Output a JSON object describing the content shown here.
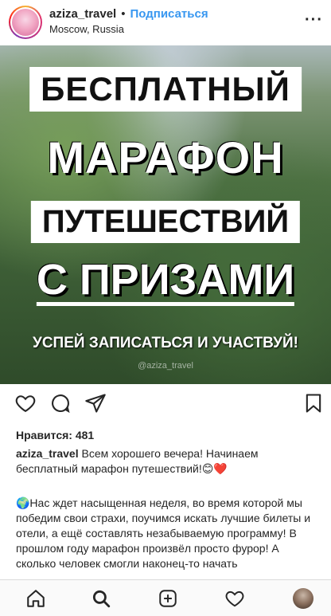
{
  "header": {
    "username": "aziza_travel",
    "separator": "•",
    "follow_label": "Подписаться",
    "location": "Moscow, Russia",
    "more_label": "···",
    "avatar_icon": "profile-avatar"
  },
  "post": {
    "line1": "БЕСПЛАТНЫЙ",
    "line2": "МАРАФОН",
    "line3": "ПУТЕШЕСТВИЙ",
    "line4": "С ПРИЗАМИ",
    "line5": "УСПЕЙ ЗАПИСАТЬСЯ И УЧАСТВУЙ!",
    "watermark": "@aziza_travel"
  },
  "actions": {
    "like_icon": "heart-icon",
    "comment_icon": "comment-icon",
    "share_icon": "send-icon",
    "save_icon": "bookmark-icon"
  },
  "likes": {
    "label": "Нравится: 481"
  },
  "caption": {
    "username": "aziza_travel",
    "text": " Всем хорошего вечера! Начинаем бесплатный марафон путешествий!😊❤️"
  },
  "body": {
    "text": "🌍Нас ждет насыщенная неделя, во время которой мы победим свои страхи, поучимся искать лучшие билеты и отели, а ещё составлять незабываемую программу! В прошлом году марафон произвёл просто фурор! А сколько человек смогли наконец-то начать"
  },
  "nav": {
    "home_icon": "home-icon",
    "search_icon": "search-icon",
    "add_icon": "add-post-icon",
    "activity_icon": "heart-icon",
    "profile_icon": "profile-avatar"
  },
  "colors": {
    "accent": "#3897f0",
    "text": "#262626",
    "border": "#dbdbdb"
  }
}
